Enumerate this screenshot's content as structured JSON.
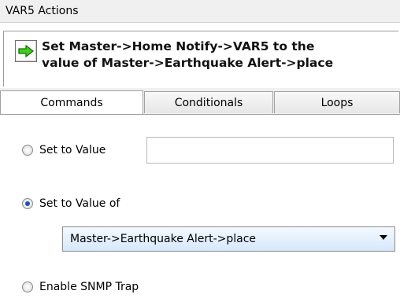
{
  "window": {
    "title": "VAR5 Actions"
  },
  "action": {
    "icon": "green-right-arrow-icon",
    "description_line1": "Set Master->Home Notify->VAR5 to the",
    "description_line2": "value of Master->Earthquake Alert->place"
  },
  "tabs": [
    {
      "label": "Commands",
      "active": true
    },
    {
      "label": "Conditionals",
      "active": false
    },
    {
      "label": "Loops",
      "active": false
    }
  ],
  "options": {
    "set_to_value": {
      "label": "Set to Value",
      "checked": false,
      "input_value": ""
    },
    "set_to_value_of": {
      "label": "Set to Value of",
      "checked": true,
      "selected": "Master->Earthquake Alert->place"
    },
    "enable_snmp_trap": {
      "label": "Enable SNMP Trap",
      "checked": false
    }
  },
  "colors": {
    "accent_green": "#3fcf1f",
    "radio_dot": "#1d4fbf",
    "select_bg": "#d5e8fb"
  }
}
